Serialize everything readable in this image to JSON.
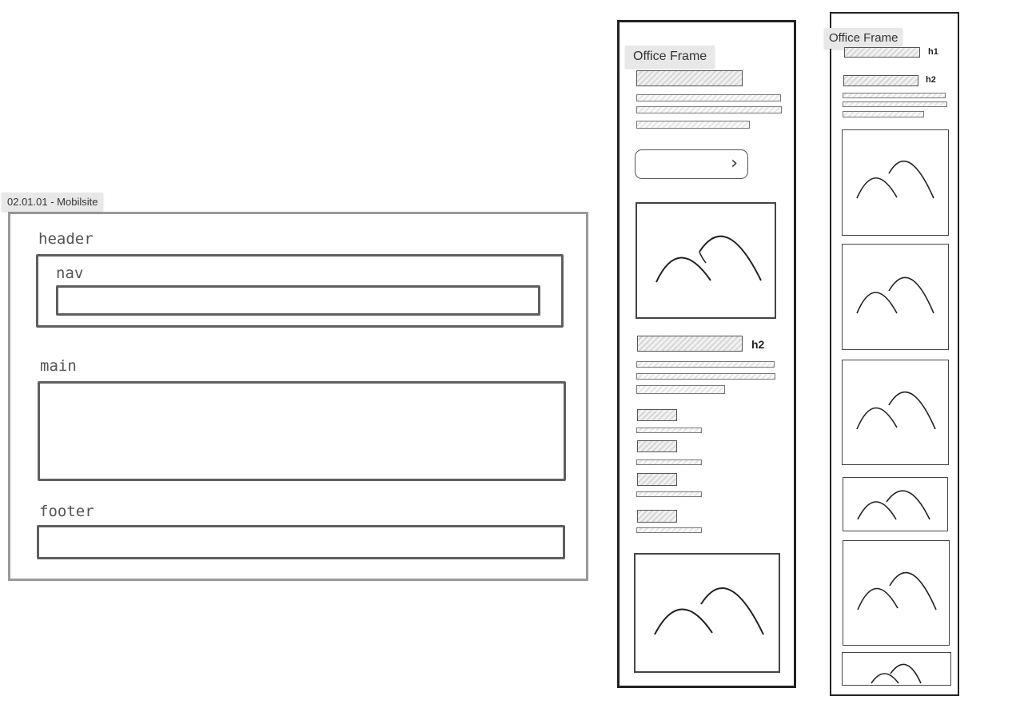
{
  "canvas": {
    "frames": [
      {
        "tag": "02.01.01 - Mobilsite"
      },
      {
        "tag": "Office Frame"
      },
      {
        "tag": "Office Frame"
      }
    ]
  },
  "layout_wireframe": {
    "header_label": "header",
    "nav_label": "nav",
    "main_label": "main",
    "footer_label": "footer"
  },
  "mobile_a": {
    "h2_label": "h2",
    "cta_icon": "chevron-right-icon",
    "image_icon": "image-placeholder-icon"
  },
  "mobile_b": {
    "h1_label": "h1",
    "h2_label": "h2",
    "image_icon": "image-placeholder-icon"
  },
  "colors": {
    "stroke": "#5f5f5f",
    "frame_border": "#9a9a9a",
    "tag_background": "#e8e8e8"
  }
}
